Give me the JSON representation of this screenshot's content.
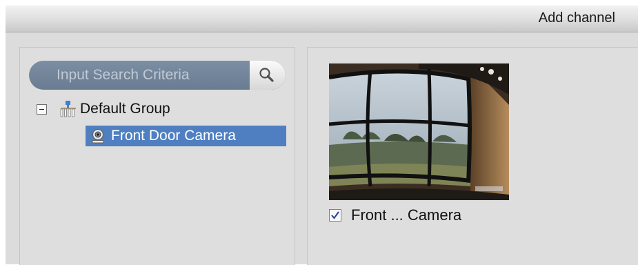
{
  "header": {
    "title": "Add channel"
  },
  "device_tree": {
    "search": {
      "placeholder": "Input Search Criteria",
      "value": ""
    },
    "group": {
      "label": "Default Group",
      "expanded": true
    },
    "channels": [
      {
        "label": "Front Door Camera",
        "selected": true
      }
    ]
  },
  "preview": {
    "tiles": [
      {
        "caption": "Front ... Camera",
        "checked": true
      }
    ]
  },
  "colors": {
    "selection": "#4f7fc1",
    "search_bar": "#74869b",
    "panel_background": "#dedede"
  },
  "icons": {
    "search": "magnifier-icon",
    "group": "device-group-icon",
    "camera": "camera-icon",
    "collapse": "minus-icon",
    "check": "checkmark-icon"
  }
}
